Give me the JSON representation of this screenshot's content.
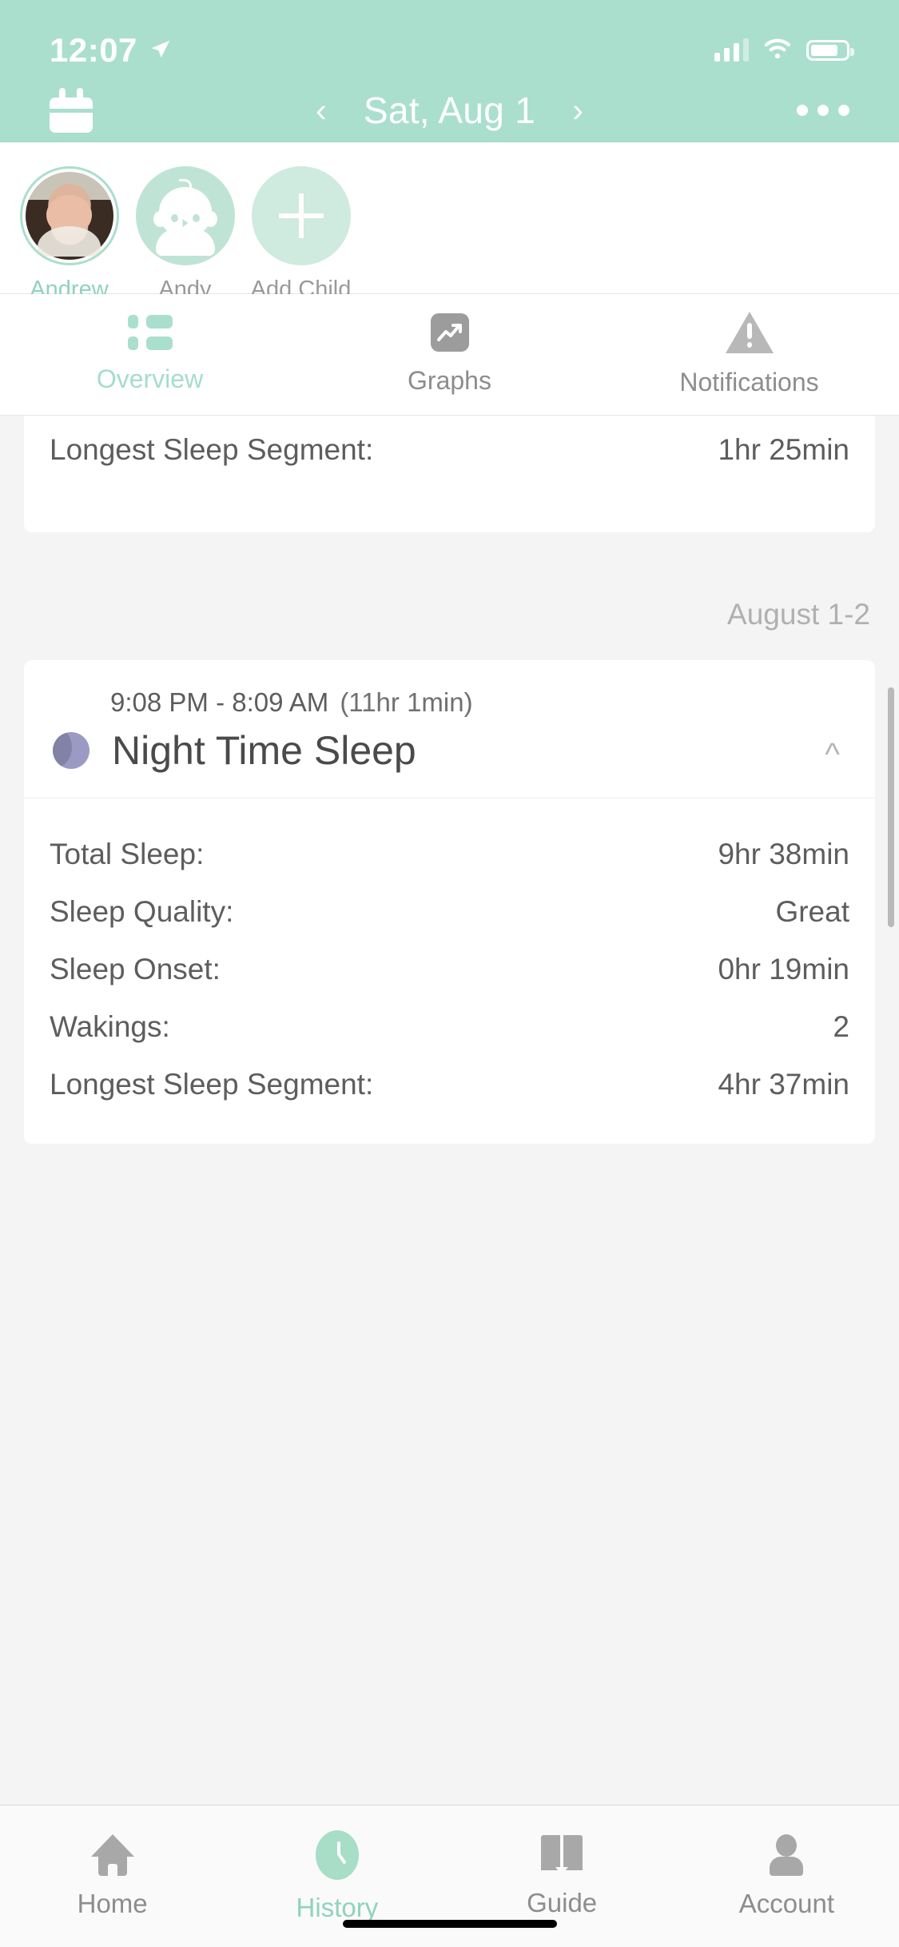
{
  "status_bar": {
    "time": "12:07",
    "location_icon": "location-arrow-icon",
    "signal_icon": "cellular-signal-icon",
    "wifi_icon": "wifi-icon",
    "battery_icon": "battery-icon"
  },
  "header": {
    "calendar_icon": "calendar-icon",
    "prev_label": "‹",
    "date": "Sat, Aug 1",
    "next_label": "›",
    "more_icon": "more-options-icon",
    "background_color": "#aadfcd"
  },
  "children": [
    {
      "name": "Andrew",
      "avatar": "photo",
      "selected": true
    },
    {
      "name": "Andy",
      "avatar": "baby-icon",
      "selected": false
    },
    {
      "name": "Add Child",
      "avatar": "plus-icon",
      "selected": false
    }
  ],
  "tabs": [
    {
      "label": "Overview",
      "icon": "list-icon",
      "active": true
    },
    {
      "label": "Graphs",
      "icon": "trending-chart-icon",
      "active": false
    },
    {
      "label": "Notifications",
      "icon": "warning-triangle-icon",
      "active": false
    }
  ],
  "clipped_card": {
    "rows": [
      {
        "key": "Longest Sleep Segment:",
        "value": "1hr 25min"
      }
    ]
  },
  "date_divider": "August 1-2",
  "sleep_entry": {
    "time_range": "9:08 PM - 8:09 AM",
    "duration": "(11hr 1min)",
    "title": "Night Time Sleep",
    "type_icon": "moon-icon",
    "collapse_icon": "chevron-up-icon",
    "rows": [
      {
        "key": "Total Sleep:",
        "value": "9hr 38min"
      },
      {
        "key": "Sleep Quality:",
        "value": "Great"
      },
      {
        "key": "Sleep Onset:",
        "value": "0hr 19min"
      },
      {
        "key": "Wakings:",
        "value": "2"
      },
      {
        "key": "Longest Sleep Segment:",
        "value": "4hr 37min"
      }
    ]
  },
  "bottom_nav": [
    {
      "label": "Home",
      "icon": "home-icon",
      "active": false
    },
    {
      "label": "History",
      "icon": "clock-icon",
      "active": true
    },
    {
      "label": "Guide",
      "icon": "book-icon",
      "active": false
    },
    {
      "label": "Account",
      "icon": "person-icon",
      "active": false
    }
  ],
  "theme": {
    "accent": "#aadfcd",
    "accent_text": "#8fd3bb",
    "text": "#5d5d5d",
    "muted": "#b0b0b0"
  }
}
